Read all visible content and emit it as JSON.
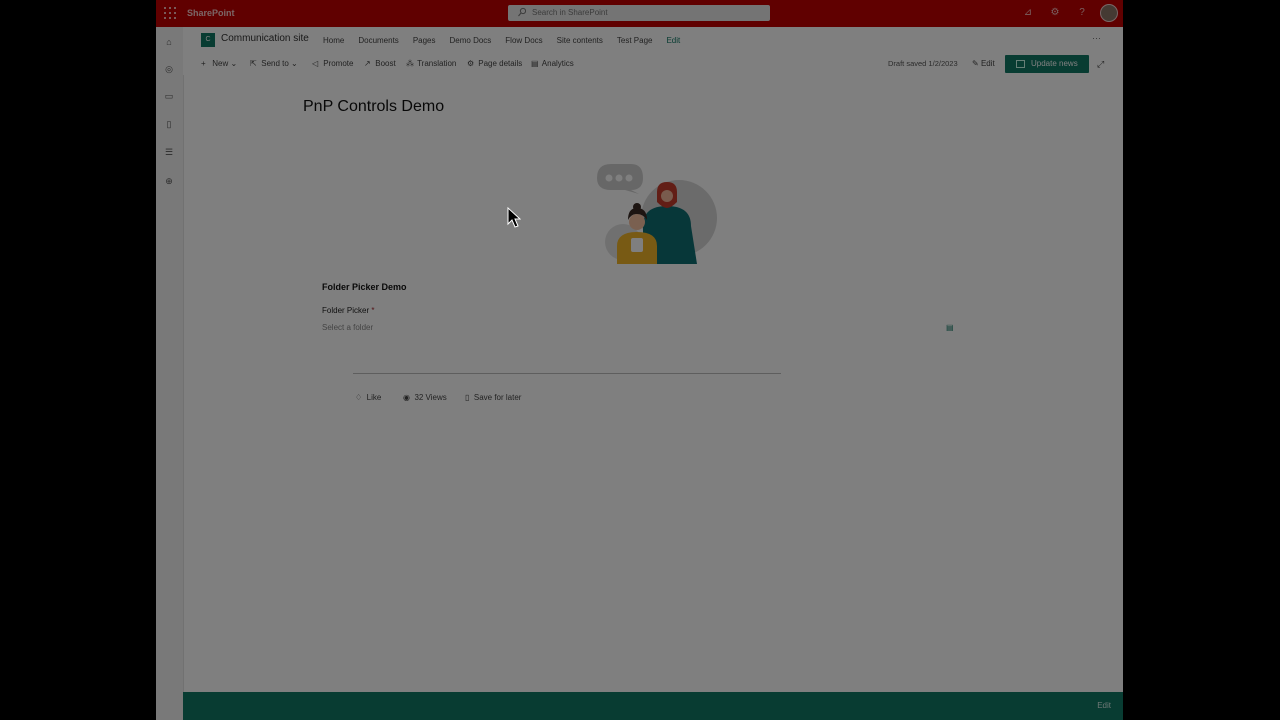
{
  "suite": {
    "app_name": "SharePoint",
    "search_placeholder": "Search in SharePoint"
  },
  "site": {
    "title": "Communication site",
    "logo_letter": "C",
    "nav": [
      "Home",
      "Documents",
      "Pages",
      "Demo Docs",
      "Flow Docs",
      "Site contents",
      "Test Page"
    ],
    "nav_edit": "Edit",
    "more": "···"
  },
  "commands": {
    "new": "New",
    "send_to": "Send to",
    "promote": "Promote",
    "boost": "Boost",
    "translation": "Translation",
    "page_details": "Page details",
    "analytics": "Analytics",
    "draft_status": "Draft saved 1/2/2023",
    "edit": "Edit",
    "update_news": "Update news"
  },
  "page": {
    "title": "PnP Controls Demo",
    "webpart_title": "Folder Picker Demo",
    "folder_picker_label": "Folder Picker",
    "required_mark": "*",
    "folder_picker_placeholder": "Select a folder"
  },
  "social": {
    "like": "Like",
    "views": "32 Views",
    "save_for_later": "Save for later"
  },
  "bottom_bar": {
    "label": "Edit"
  },
  "colors": {
    "suite_bar": "#c00000",
    "accent": "#117865"
  }
}
